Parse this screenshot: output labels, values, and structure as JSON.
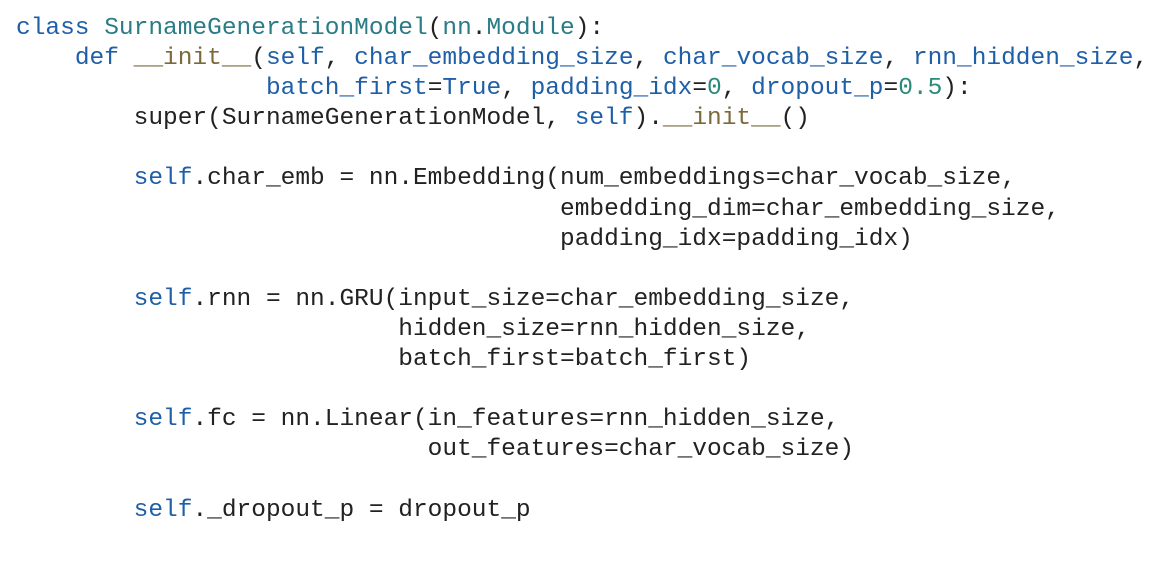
{
  "colors": {
    "background": "#ffffff",
    "text": "#222222",
    "keyword": "#1f5fa8",
    "class_name": "#2a7c86",
    "dunder": "#7d6a3a",
    "number": "#2a8a7a"
  },
  "code": {
    "lines": [
      [
        {
          "t": "kw",
          "v": "class"
        },
        {
          "t": "plain",
          "v": " "
        },
        {
          "t": "cls",
          "v": "SurnameGenerationModel"
        },
        {
          "t": "plain",
          "v": "("
        },
        {
          "t": "cls",
          "v": "nn"
        },
        {
          "t": "plain",
          "v": "."
        },
        {
          "t": "cls",
          "v": "Module"
        },
        {
          "t": "plain",
          "v": "):"
        }
      ],
      [
        {
          "t": "plain",
          "v": "    "
        },
        {
          "t": "kw",
          "v": "def"
        },
        {
          "t": "plain",
          "v": " "
        },
        {
          "t": "dunder",
          "v": "__init__"
        },
        {
          "t": "plain",
          "v": "("
        },
        {
          "t": "self",
          "v": "self"
        },
        {
          "t": "plain",
          "v": ", "
        },
        {
          "t": "kw",
          "v": "char_embedding_size"
        },
        {
          "t": "plain",
          "v": ", "
        },
        {
          "t": "kw",
          "v": "char_vocab_size"
        },
        {
          "t": "plain",
          "v": ", "
        },
        {
          "t": "kw",
          "v": "rnn_hidden_size"
        },
        {
          "t": "plain",
          "v": ","
        }
      ],
      [
        {
          "t": "plain",
          "v": "                 "
        },
        {
          "t": "kw",
          "v": "batch_first"
        },
        {
          "t": "plain",
          "v": "="
        },
        {
          "t": "kw",
          "v": "True"
        },
        {
          "t": "plain",
          "v": ", "
        },
        {
          "t": "kw",
          "v": "padding_idx"
        },
        {
          "t": "plain",
          "v": "="
        },
        {
          "t": "num",
          "v": "0"
        },
        {
          "t": "plain",
          "v": ", "
        },
        {
          "t": "kw",
          "v": "dropout_p"
        },
        {
          "t": "plain",
          "v": "="
        },
        {
          "t": "num",
          "v": "0.5"
        },
        {
          "t": "plain",
          "v": "):"
        }
      ],
      [
        {
          "t": "plain",
          "v": "        super(SurnameGenerationModel, "
        },
        {
          "t": "self",
          "v": "self"
        },
        {
          "t": "plain",
          "v": ")."
        },
        {
          "t": "dunder",
          "v": "__init__"
        },
        {
          "t": "plain",
          "v": "()"
        }
      ],
      [],
      [
        {
          "t": "plain",
          "v": "        "
        },
        {
          "t": "self",
          "v": "self"
        },
        {
          "t": "plain",
          "v": ".char_emb = nn.Embedding(num_embeddings=char_vocab_size,"
        }
      ],
      [
        {
          "t": "plain",
          "v": "                                     embedding_dim=char_embedding_size,"
        }
      ],
      [
        {
          "t": "plain",
          "v": "                                     padding_idx=padding_idx)"
        }
      ],
      [],
      [
        {
          "t": "plain",
          "v": "        "
        },
        {
          "t": "self",
          "v": "self"
        },
        {
          "t": "plain",
          "v": ".rnn = nn.GRU(input_size=char_embedding_size,"
        }
      ],
      [
        {
          "t": "plain",
          "v": "                          hidden_size=rnn_hidden_size,"
        }
      ],
      [
        {
          "t": "plain",
          "v": "                          batch_first=batch_first)"
        }
      ],
      [],
      [
        {
          "t": "plain",
          "v": "        "
        },
        {
          "t": "self",
          "v": "self"
        },
        {
          "t": "plain",
          "v": ".fc = nn.Linear(in_features=rnn_hidden_size,"
        }
      ],
      [
        {
          "t": "plain",
          "v": "                            out_features=char_vocab_size)"
        }
      ],
      [],
      [
        {
          "t": "plain",
          "v": "        "
        },
        {
          "t": "self",
          "v": "self"
        },
        {
          "t": "plain",
          "v": "._dropout_p = dropout_p"
        }
      ]
    ]
  }
}
